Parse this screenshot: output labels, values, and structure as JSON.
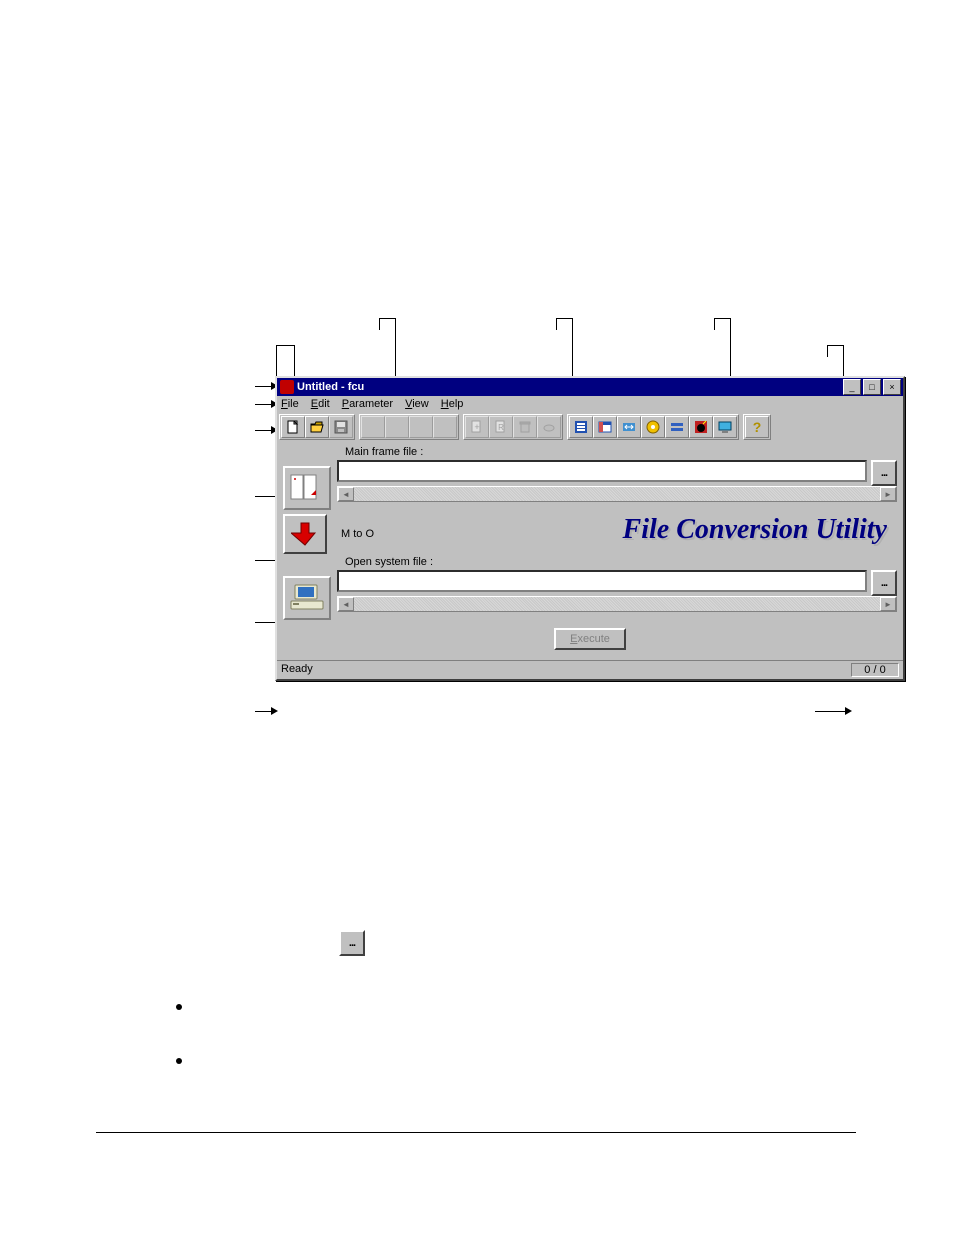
{
  "window": {
    "title": "Untitled - fcu",
    "sysbuttons": {
      "min": "_",
      "max": "□",
      "close": "×"
    }
  },
  "menubar": [
    "File",
    "Edit",
    "Parameter",
    "View",
    "Help"
  ],
  "toolbar_groups": {
    "file": [
      "new",
      "open",
      "save"
    ],
    "edit": [
      "b1",
      "b2",
      "b3",
      "b4"
    ],
    "page": [
      "p1",
      "p2",
      "p3",
      "p4"
    ],
    "opts": [
      "o1",
      "o2",
      "o3",
      "o4",
      "o5",
      "o6",
      "o7"
    ],
    "help": [
      "help"
    ]
  },
  "labels": {
    "mainframe_label": "Main frame file :",
    "mto": "M to O",
    "open_label": "Open system file :",
    "big_title": "File Conversion Utility",
    "execute": "Execute",
    "browse": "..."
  },
  "fields": {
    "mainframe_value": "",
    "open_value": ""
  },
  "statusbar": {
    "left": "Ready",
    "right": "0 / 0"
  }
}
